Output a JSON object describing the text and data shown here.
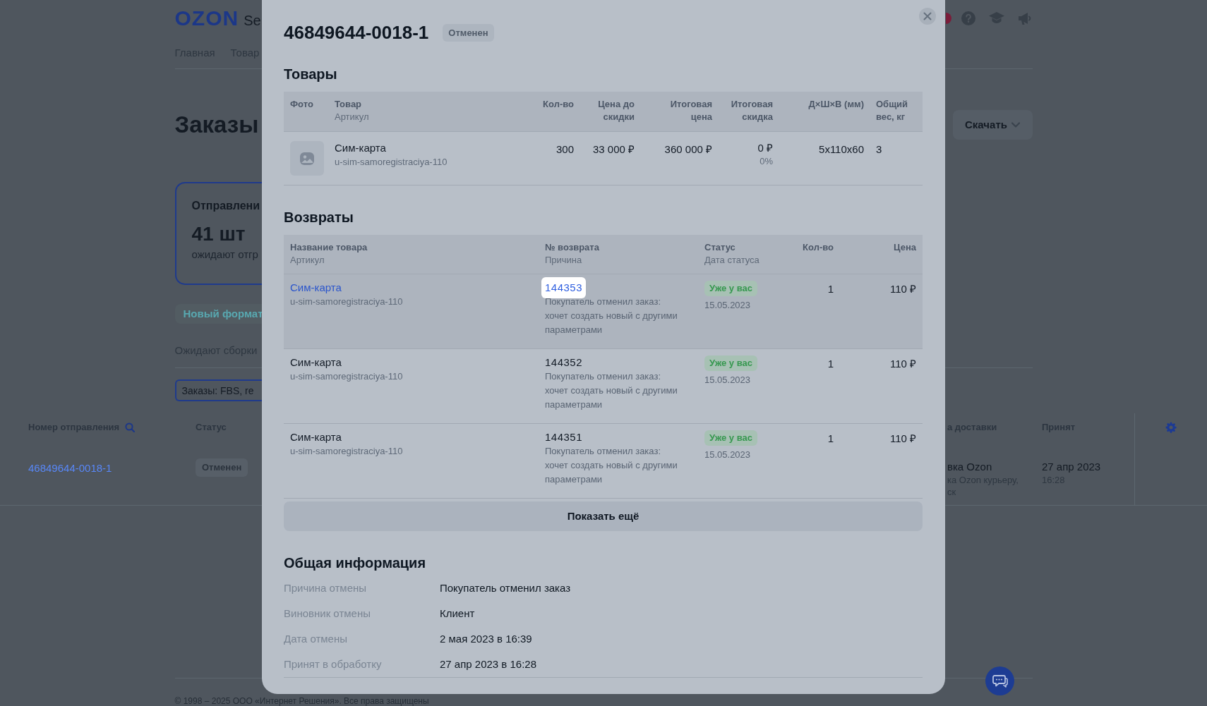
{
  "background_page": {
    "logo": {
      "brand": "OZON",
      "suffix": "Se"
    },
    "nav": [
      {
        "label": "Главная"
      },
      {
        "label": "Товар"
      }
    ],
    "title": "Заказы",
    "download_button": {
      "label": "Скачать"
    },
    "summary_card": {
      "title": "Отправлени",
      "count": "41 шт",
      "caption": "ожидают отгр"
    },
    "format_badge": "Новый формат",
    "tabs": [
      {
        "label": "Ожидают сборки",
        "selected": false
      }
    ],
    "filter_field": {
      "value": "Заказы: FBS, re"
    },
    "orders_table": {
      "columns": [
        {
          "label": "Номер отправления",
          "search": true
        },
        {
          "label": "Статус",
          "search": false
        },
        {
          "label": "а доставки",
          "search": false
        },
        {
          "label": "Принят",
          "search": false
        }
      ],
      "rows": [
        {
          "number": "46849644-0018-1",
          "status": "Отменен",
          "column_3": {
            "value": "вка Ozon",
            "details": [
              "ка Ozon курьеру,",
              "ск"
            ]
          },
          "accepted": {
            "date": "27 апр 2023",
            "time": "16:28"
          }
        }
      ]
    },
    "footer": "© 1998 – 2025 ООО «Интернет Решения». Все права защищены"
  },
  "modal": {
    "title": "46849644-0018-1",
    "status": "Отменен",
    "products": {
      "heading": "Товары",
      "columns": [
        {
          "label": "Фото"
        },
        {
          "label": "Товар",
          "sublabel": "Артикул"
        },
        {
          "label": "Кол-во"
        },
        {
          "label": "Цена до скидки"
        },
        {
          "label": "Итоговая цена"
        },
        {
          "label": "Итоговая скидка"
        },
        {
          "label": "Д×Ш×В (мм)"
        },
        {
          "label": "Общий вес, кг"
        }
      ],
      "rows": [
        {
          "name": "Сим-карта",
          "sku": "u-sim-samoregistraciya-110",
          "quantity": "300",
          "price_before_discount": "33 000 ₽",
          "final_price": "360 000 ₽",
          "final_discount": "0 ₽",
          "discount_percent": "0%",
          "dimensions": "5x110x60",
          "weight": "3"
        }
      ]
    },
    "returns": {
      "heading": "Возвраты",
      "columns": [
        {
          "label": "Название товара",
          "sublabel": "Артикул"
        },
        {
          "label": "№ возврата",
          "sublabel": "Причина"
        },
        {
          "label": "Статус",
          "sublabel": "Дата статуса"
        },
        {
          "label": "Кол-во"
        },
        {
          "label": "Цена"
        }
      ],
      "rows": [
        {
          "hovered": true,
          "name": "Сим-карта",
          "sku": "u-sim-samoregistraciya-110",
          "return_number": "144353",
          "reason": "Покупатель отменил заказ: хочет создать новый с другими параметрами",
          "status": "Уже у вас",
          "status_date": "15.05.2023",
          "quantity": "1",
          "price": "110 ₽"
        },
        {
          "hovered": false,
          "name": "Сим-карта",
          "sku": "u-sim-samoregistraciya-110",
          "return_number": "144352",
          "reason": "Покупатель отменил заказ: хочет создать новый с другими параметрами",
          "status": "Уже у вас",
          "status_date": "15.05.2023",
          "quantity": "1",
          "price": "110 ₽"
        },
        {
          "hovered": false,
          "name": "Сим-карта",
          "sku": "u-sim-samoregistraciya-110",
          "return_number": "144351",
          "reason": "Покупатель отменил заказ: хочет создать новый с другими параметрами",
          "status": "Уже у вас",
          "status_date": "15.05.2023",
          "quantity": "1",
          "price": "110 ₽"
        }
      ]
    },
    "show_more_button": "Показать ещё",
    "general_info": {
      "heading": "Общая информация",
      "items": [
        {
          "label": "Причина отмены",
          "value": "Покупатель отменил заказ"
        },
        {
          "label": "Виновник отмены",
          "value": "Клиент"
        },
        {
          "label": "Дата отмены",
          "value": "2 мая 2023 в 16:39"
        },
        {
          "label": "Принят в обработку",
          "value": "27 апр 2023 в 16:28"
        }
      ]
    }
  }
}
